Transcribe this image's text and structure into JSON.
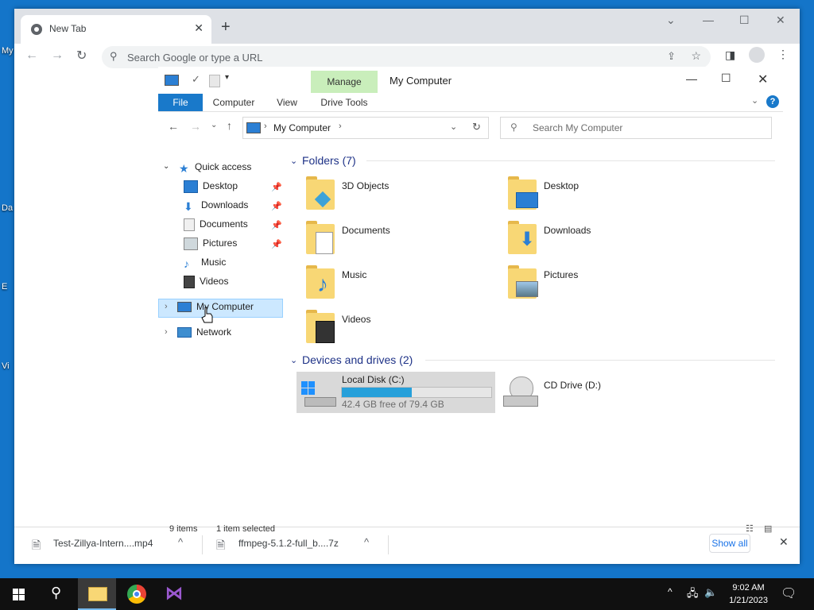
{
  "desktop": {
    "icon_labels": [
      "My",
      "Da",
      "E",
      "Vi"
    ]
  },
  "browser": {
    "tab_title": "New Tab",
    "omnibox_placeholder": "Search Google or type a URL"
  },
  "explorer": {
    "window_title": "My Computer",
    "ribbon": {
      "manage_label": "Manage",
      "tabs": [
        "File",
        "Computer",
        "View",
        "Drive Tools"
      ]
    },
    "address": {
      "path": "My Computer"
    },
    "search_placeholder": "Search My Computer",
    "nav": {
      "quick_access": "Quick access",
      "quick_items": [
        "Desktop",
        "Downloads",
        "Documents",
        "Pictures",
        "Music",
        "Videos"
      ],
      "my_computer": "My Computer",
      "network": "Network"
    },
    "folders": {
      "heading": "Folders (7)",
      "items": [
        "3D Objects",
        "Desktop",
        "Documents",
        "Downloads",
        "Music",
        "Pictures",
        "Videos"
      ]
    },
    "drives": {
      "heading": "Devices and drives (2)",
      "local": {
        "name": "Local Disk (C:)",
        "free_text": "42.4 GB free of 79.4 GB",
        "used_fraction": 0.466
      },
      "cd": {
        "name": "CD Drive (D:)"
      }
    },
    "status": {
      "items": "9 items",
      "selected": "1 item selected"
    }
  },
  "downloads": {
    "items": [
      "Test-Zillya-Intern....mp4",
      "ffmpeg-5.1.2-full_b....7z"
    ],
    "show_all": "Show all"
  },
  "taskbar": {
    "time": "9:02 AM",
    "date": "1/21/2023"
  },
  "colors": {
    "accent": "#1979ca",
    "selection": "#cce8ff",
    "manage": "#c9eebb",
    "progress": "#26a0da"
  }
}
